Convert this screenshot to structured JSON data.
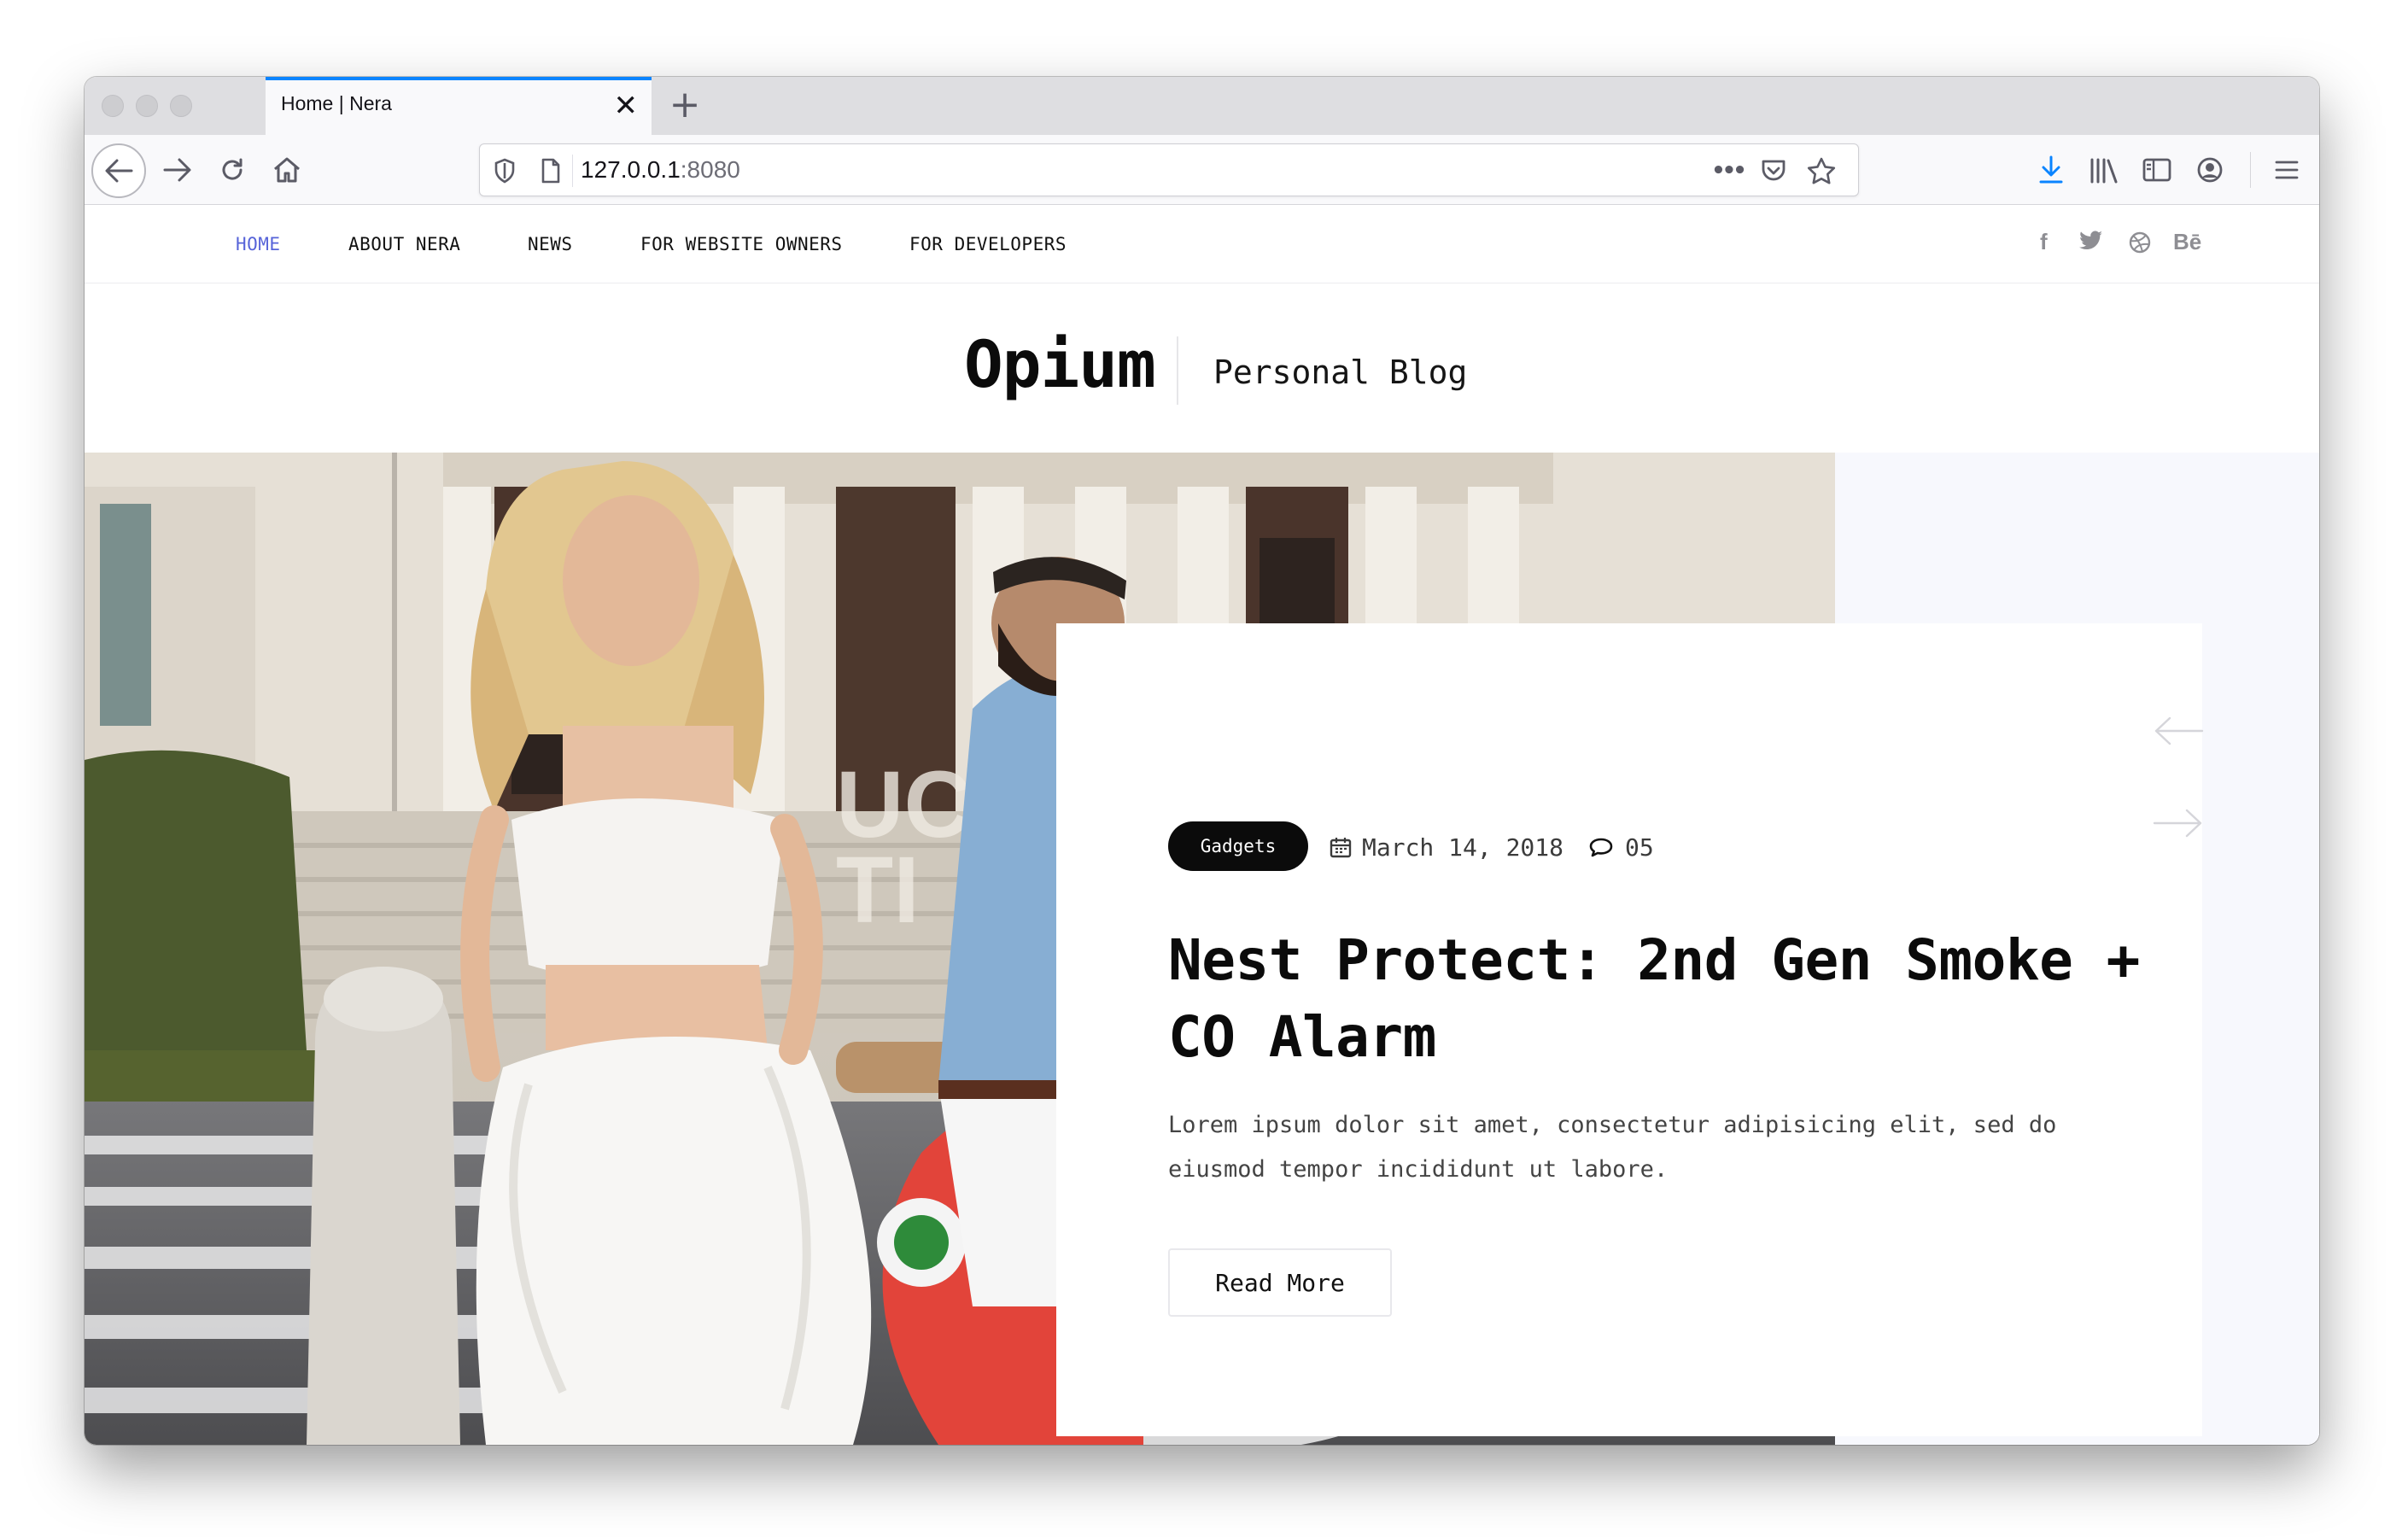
{
  "browser": {
    "tab_title": "Home | Nera",
    "tab_close": "✕",
    "new_tab": "+",
    "url_host": "127.0.0.1",
    "url_port": ":8080",
    "url_more": "•••"
  },
  "nav": {
    "items": [
      {
        "label": "HOME",
        "active": true
      },
      {
        "label": "ABOUT NERA"
      },
      {
        "label": "NEWS"
      },
      {
        "label": "FOR WEBSITE OWNERS"
      },
      {
        "label": "FOR DEVELOPERS"
      }
    ],
    "social": [
      "f",
      "Bē"
    ]
  },
  "brand": {
    "logo": "Opium",
    "tagline": "Personal Blog"
  },
  "featured": {
    "category": "Gadgets",
    "date": "March 14, 2018",
    "comments": "05",
    "title": "Nest Protect: 2nd Gen Smoke + CO Alarm",
    "excerpt": "Lorem ipsum dolor sit amet, consectetur adipisicing elit, sed do eiusmod tempor incididunt ut labore.",
    "read_more": "Read More"
  },
  "colors": {
    "accent": "#5764d9",
    "tab_highlight": "#0a84ff",
    "download_icon": "#0a84ff",
    "hero_bg": "#f7f8fd",
    "scooter": "#e2443a"
  }
}
